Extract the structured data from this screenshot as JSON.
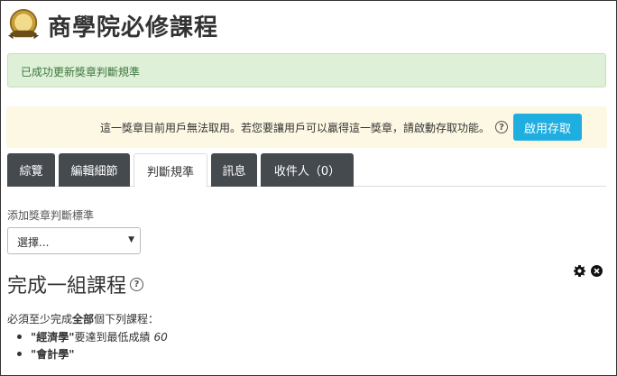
{
  "header": {
    "title": "商學院必修課程"
  },
  "alerts": {
    "success": "已成功更新獎章判斷規準",
    "warning_text": "這一獎章目前用戶無法取用。若您要讓用戶可以贏得這一獎章，請啟動存取功能。",
    "enable_button": "啟用存取"
  },
  "tabs": [
    {
      "label": "綜覽"
    },
    {
      "label": "編輯細節"
    },
    {
      "label": "判斷規準"
    },
    {
      "label": "訊息"
    },
    {
      "label": "收件人（0）"
    }
  ],
  "criteria": {
    "add_label": "添加獎章判斷標準",
    "select_value": "選擇..."
  },
  "section": {
    "title": "完成一組課程",
    "desc_prefix": "必須至少完成",
    "desc_bold": "全部",
    "desc_suffix": "個下列課程：",
    "courses": [
      {
        "name": "\"經濟學\"",
        "suffix": "要達到最低成績",
        "grade": "60"
      },
      {
        "name": "\"會計學\"",
        "suffix": "",
        "grade": ""
      }
    ]
  },
  "colors": {
    "tab_dark": "#454a4f",
    "primary": "#1faee0",
    "success_bg": "#dff0d8",
    "warning_bg": "#fcf8e3"
  }
}
